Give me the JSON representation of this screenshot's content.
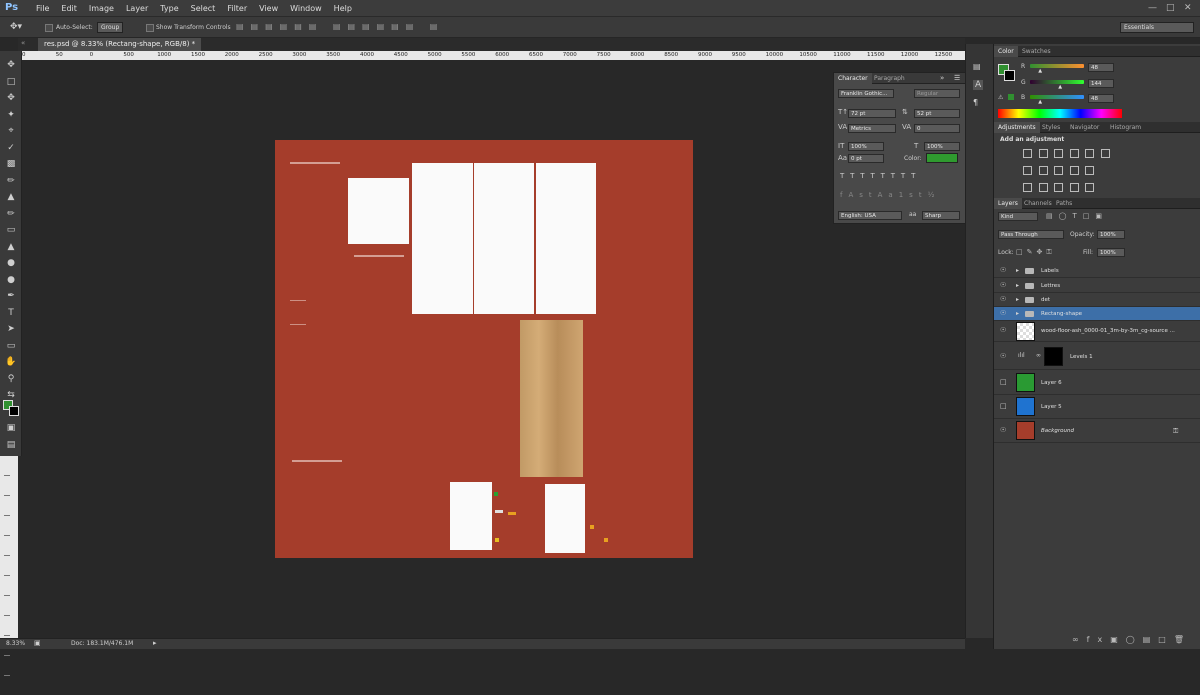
{
  "app": {
    "logo": "Ps",
    "workspace": "Essentials"
  },
  "menu": [
    "File",
    "Edit",
    "Image",
    "Layer",
    "Type",
    "Select",
    "Filter",
    "View",
    "Window",
    "Help"
  ],
  "options": {
    "auto_select_label": "Auto-Select:",
    "auto_select_value": "Group",
    "show_transform_label": "Show Transform Controls"
  },
  "document": {
    "tab_title": "res.psd @ 8.33% (Rectang-shape, RGB/8) *",
    "zoom": "8.33%",
    "doc_size": "Doc: 183.1M/476.1M"
  },
  "ruler": {
    "h": [
      "0",
      "50",
      "0",
      "500",
      "1000",
      "1500",
      "2000",
      "2500",
      "3000",
      "3500",
      "4000",
      "4500",
      "5000",
      "5500",
      "6000",
      "6500",
      "7000",
      "7500",
      "8000",
      "8500",
      "9000",
      "9500",
      "10000",
      "10500",
      "11000",
      "11500",
      "12000",
      "12500"
    ]
  },
  "character": {
    "tabs": [
      "Character",
      "Paragraph"
    ],
    "font_family": "Franklin Gothic...",
    "font_style": "Regular",
    "size": "72 pt",
    "leading": "52 pt",
    "kerning": "Metrics",
    "tracking": "0",
    "vscale": "100%",
    "hscale": "100%",
    "baseline": "0 pt",
    "color_label": "Color:",
    "language": "English: USA",
    "antialias": "Sharp",
    "color": "#2f9a2f"
  },
  "color_panel": {
    "tabs": [
      "Color",
      "Swatches"
    ],
    "r_label": "R",
    "g_label": "G",
    "b_label": "B",
    "r": "48",
    "g": "144",
    "b": "48",
    "r_level": 0.19,
    "g_level": 0.56,
    "b_level": 0.19,
    "fg": "#309030",
    "bg": "#000000"
  },
  "adjustments": {
    "tabs": [
      "Adjustments",
      "Styles",
      "Navigator",
      "Histogram"
    ],
    "heading": "Add an adjustment"
  },
  "layers_panel": {
    "tabs": [
      "Layers",
      "Channels",
      "Paths"
    ],
    "filter": "Kind",
    "blend": "Pass Through",
    "opacity_label": "Opacity:",
    "opacity": "100%",
    "lock_label": "Lock:",
    "fill_label": "Fill:",
    "fill": "100%",
    "layers": [
      {
        "name": "Labels",
        "kind": "group"
      },
      {
        "name": "Lettres",
        "kind": "group"
      },
      {
        "name": "det",
        "kind": "group"
      },
      {
        "name": "Rectang-shape",
        "kind": "group"
      },
      {
        "name": "wood-floor-ash_0000-01_3m-by-3m_cg-source ...",
        "kind": "image"
      },
      {
        "name": "Levels 1",
        "kind": "adjustment"
      },
      {
        "name": "Layer 6",
        "kind": "fill",
        "color": "#2a9a33"
      },
      {
        "name": "Layer 5",
        "kind": "fill",
        "color": "#1f73d0"
      },
      {
        "name": "Background",
        "kind": "fill",
        "color": "#a53d2b"
      }
    ]
  },
  "colors": {
    "canvas": "#a53d2b",
    "accent": "#3d6fa8"
  }
}
